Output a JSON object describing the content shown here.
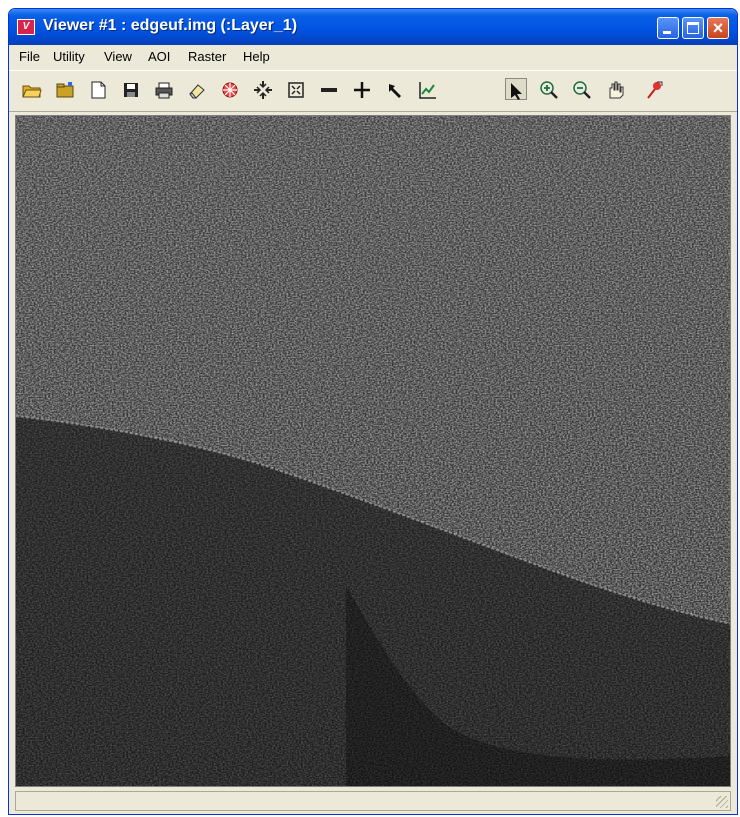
{
  "window": {
    "title": "Viewer #1 : edgeuf.img (:Layer_1)",
    "app_icon_glyph": "V",
    "controls": {
      "minimize": "minimize-icon",
      "maximize": "maximize-icon",
      "close": "×"
    }
  },
  "menu": [
    "File",
    "Utility",
    "View",
    "AOI",
    "Raster",
    "Help"
  ],
  "toolbar": {
    "tools": [
      "open-folder-icon",
      "open-layer-icon",
      "new-document-icon",
      "save-icon",
      "print-icon",
      "erase-icon",
      "radiometric-icon",
      "fit-extent-icon",
      "fit-window-icon",
      "measure-line-icon",
      "crosshair-icon",
      "inquire-cursor-icon",
      "profile-icon",
      "select-arrow-icon",
      "zoom-in-icon",
      "zoom-out-icon",
      "pan-hand-icon",
      "info-pin-icon"
    ],
    "active_tool": "select-arrow-icon"
  },
  "viewport": {
    "content": "grayscale edge-filtered raster image"
  },
  "colors": {
    "title_blue": "#0054e3",
    "chrome": "#ece9d8",
    "close_red": "#c9431e"
  }
}
